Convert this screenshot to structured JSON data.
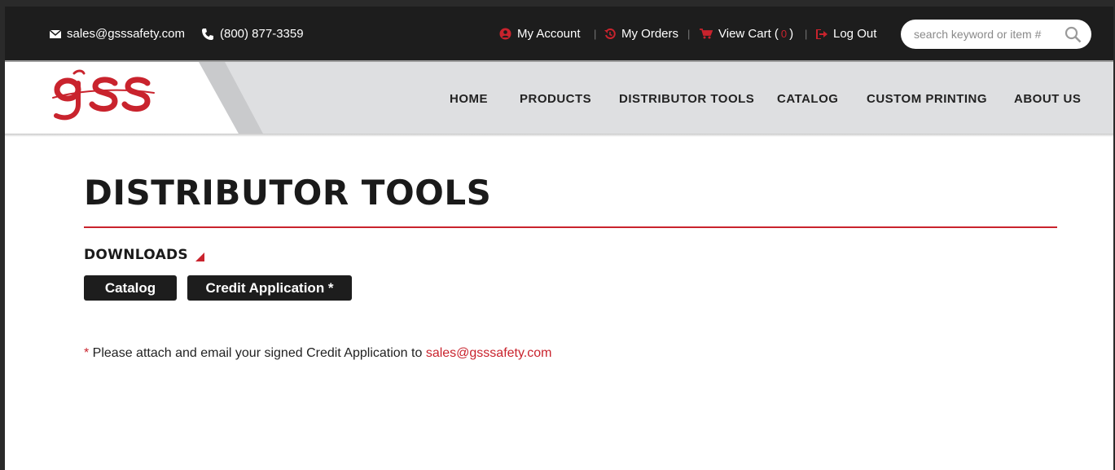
{
  "topbar": {
    "email": "sales@gsssafety.com",
    "phone": "(800) 877-3359",
    "my_account": "My Account",
    "my_orders": "My Orders",
    "view_cart": "View Cart (",
    "cart_count": "0",
    "view_cart_close": ")",
    "log_out": "Log Out",
    "separator": "|",
    "search_placeholder": "search keyword or item #"
  },
  "logo": {
    "text": "gss",
    "color": "#c9232d"
  },
  "nav": {
    "items": [
      "HOME",
      "PRODUCTS",
      "DISTRIBUTOR TOOLS",
      "CATALOG",
      "CUSTOM PRINTING",
      "ABOUT US"
    ]
  },
  "main": {
    "title": "DISTRIBUTOR TOOLS",
    "downloads_label": "DOWNLOADS",
    "buttons": [
      "Catalog",
      "Credit Application *"
    ],
    "note_star": "*",
    "note_text": " Please attach and email your signed Credit Application to ",
    "note_email": "sales@gsssafety.com"
  },
  "colors": {
    "accent": "#c9232d",
    "topbar": "#1d1d1d",
    "navbar": "#dedfe1"
  }
}
